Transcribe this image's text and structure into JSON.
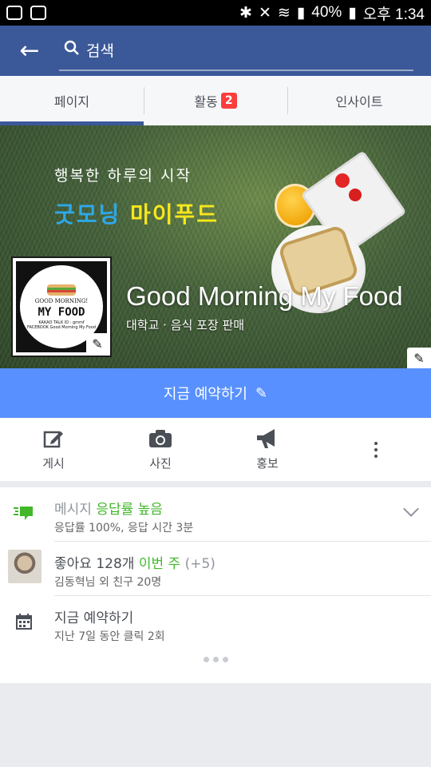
{
  "status_bar": {
    "battery": "40%",
    "time": "오후 1:34"
  },
  "app_bar": {
    "search_placeholder": "검색"
  },
  "tabs": [
    {
      "label": "페이지"
    },
    {
      "label": "활동",
      "badge": "2"
    },
    {
      "label": "인사이트"
    }
  ],
  "cover": {
    "tagline": "행복한 하루의 시작",
    "headline_part1": "굿모닝",
    "headline_part2": "마이푸드",
    "page_name": "Good Morning My Food",
    "category": "대학교 · 음식 포장 판매"
  },
  "profile_logo": {
    "line1": "GOOD MORNING!",
    "line2": "MY FOOD",
    "line3": "KAKAO TALK ID : gmmf",
    "line4": "FACEBOOK   Good Morning My Food"
  },
  "cta": {
    "label": "지금 예약하기"
  },
  "actions": [
    {
      "label": "게시",
      "icon": "edit-icon"
    },
    {
      "label": "사진",
      "icon": "camera-icon"
    },
    {
      "label": "홍보",
      "icon": "megaphone-icon"
    }
  ],
  "info": {
    "messages": {
      "label": "메시지",
      "highlight": "응답률 높음",
      "detail": "응답률 100%, 응답 시간 3분"
    },
    "likes": {
      "label": "좋아요 128개",
      "highlight": "이번 주",
      "delta": "(+5)",
      "detail": "김동혁님 외 친구 20명"
    },
    "booking": {
      "label": "지금 예약하기",
      "detail": "지난 7일 동안 클릭 2회"
    }
  },
  "colors": {
    "brand": "#3b5998",
    "cta": "#5890ff",
    "badge": "#fa3e3e",
    "positive": "#42b72a"
  }
}
